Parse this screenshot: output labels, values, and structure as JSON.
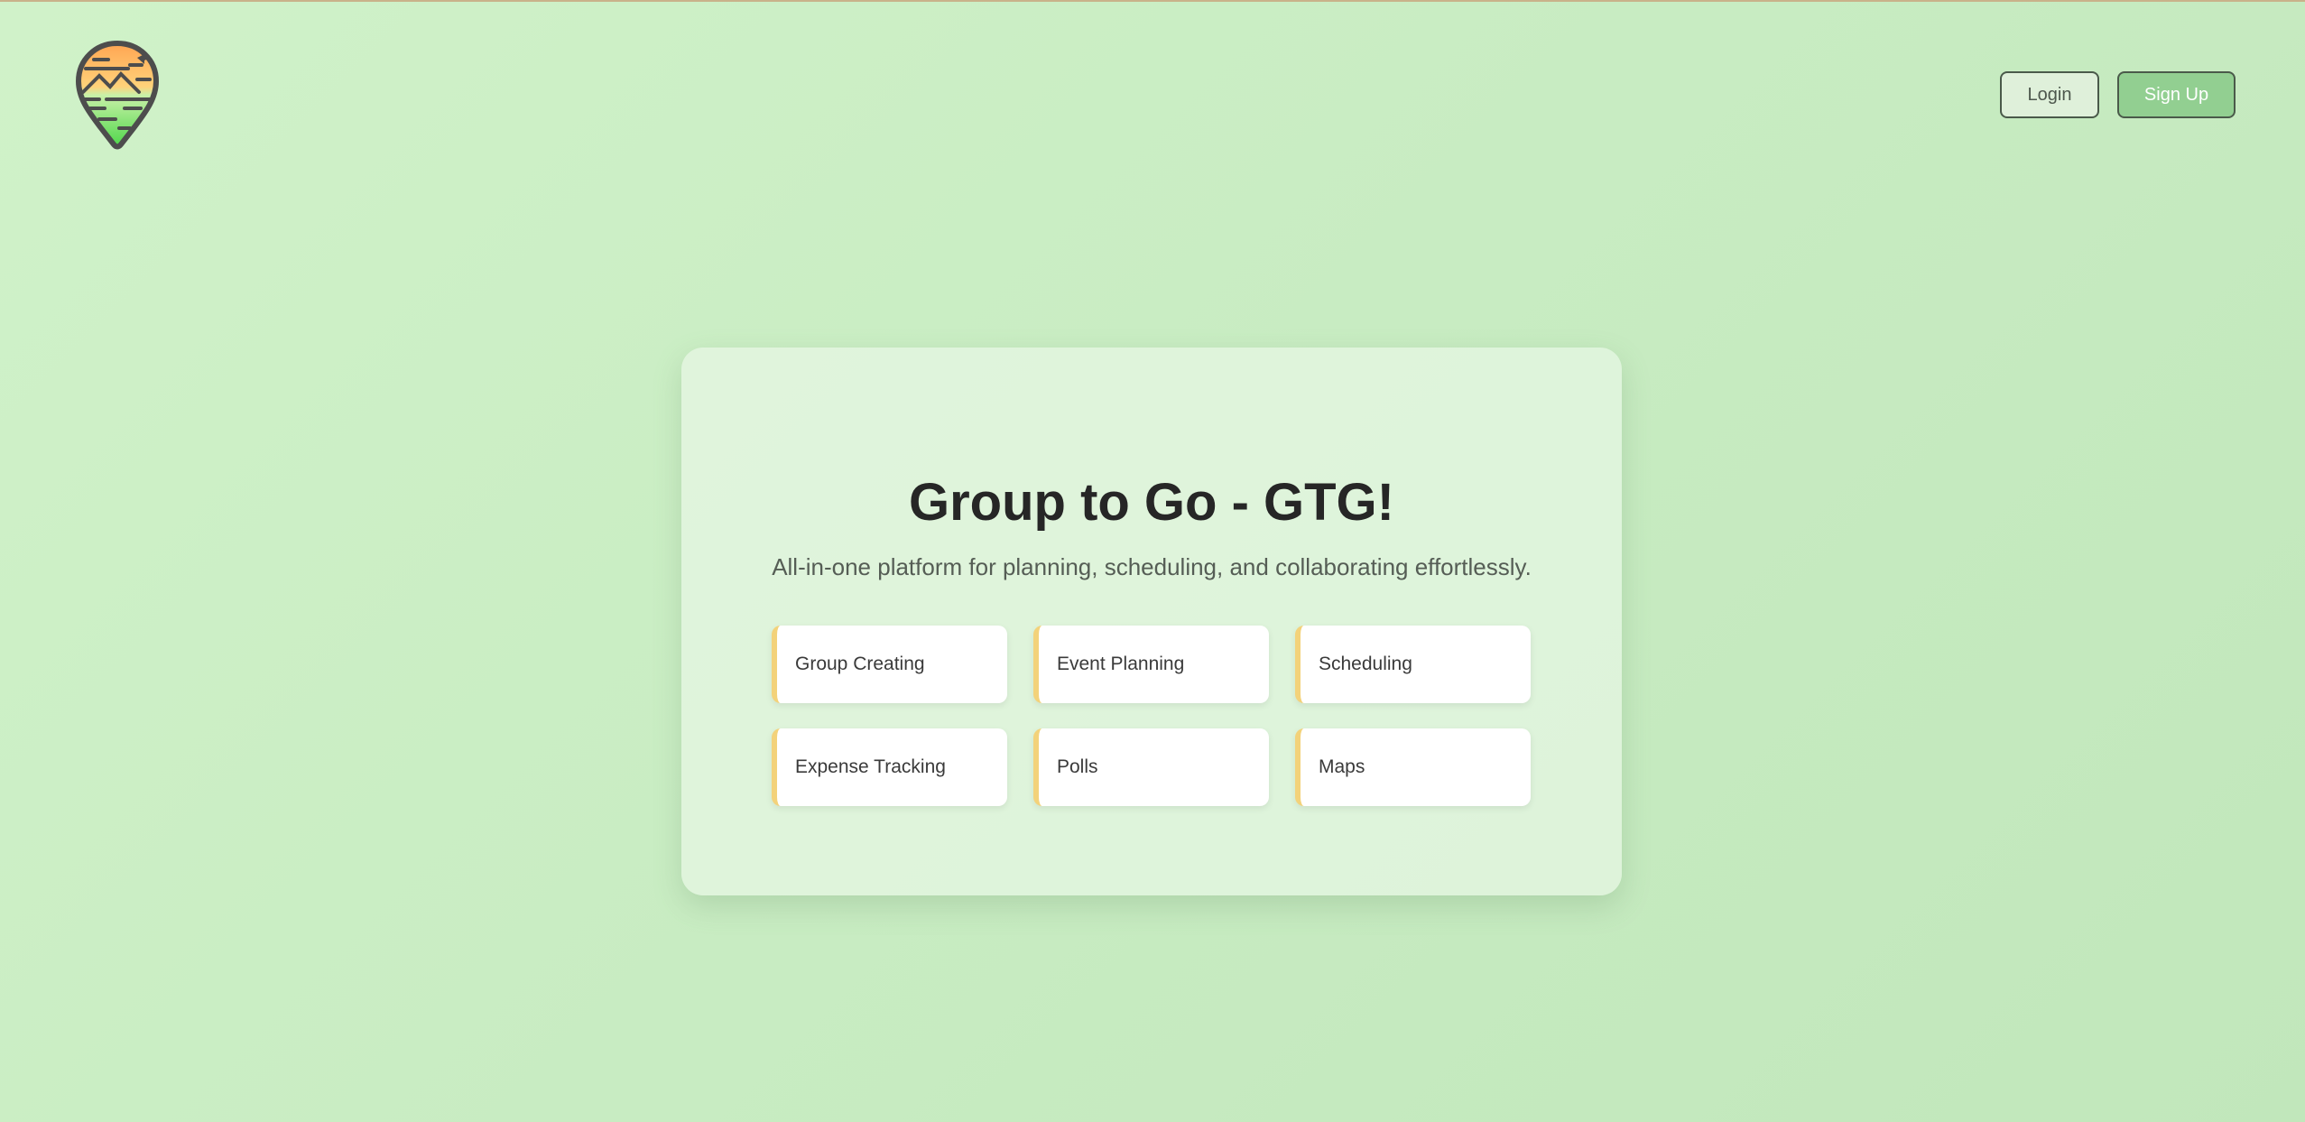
{
  "logo": {
    "icon": "map-pin-landscape-icon"
  },
  "header": {
    "login_label": "Login",
    "signup_label": "Sign Up"
  },
  "hero": {
    "title": "Group to Go - GTG!",
    "subtitle": "All-in-one platform for planning, scheduling, and collaborating effortlessly."
  },
  "features": [
    {
      "label": "Group Creating"
    },
    {
      "label": "Event Planning"
    },
    {
      "label": "Scheduling"
    },
    {
      "label": "Expense Tracking"
    },
    {
      "label": "Polls"
    },
    {
      "label": "Maps"
    }
  ],
  "colors": {
    "background": "#c8ecc2",
    "signup_button": "#92cf91",
    "feature_accent": "#f3d27a",
    "logo_top": "#ffa552",
    "logo_bottom": "#4ed84a"
  }
}
